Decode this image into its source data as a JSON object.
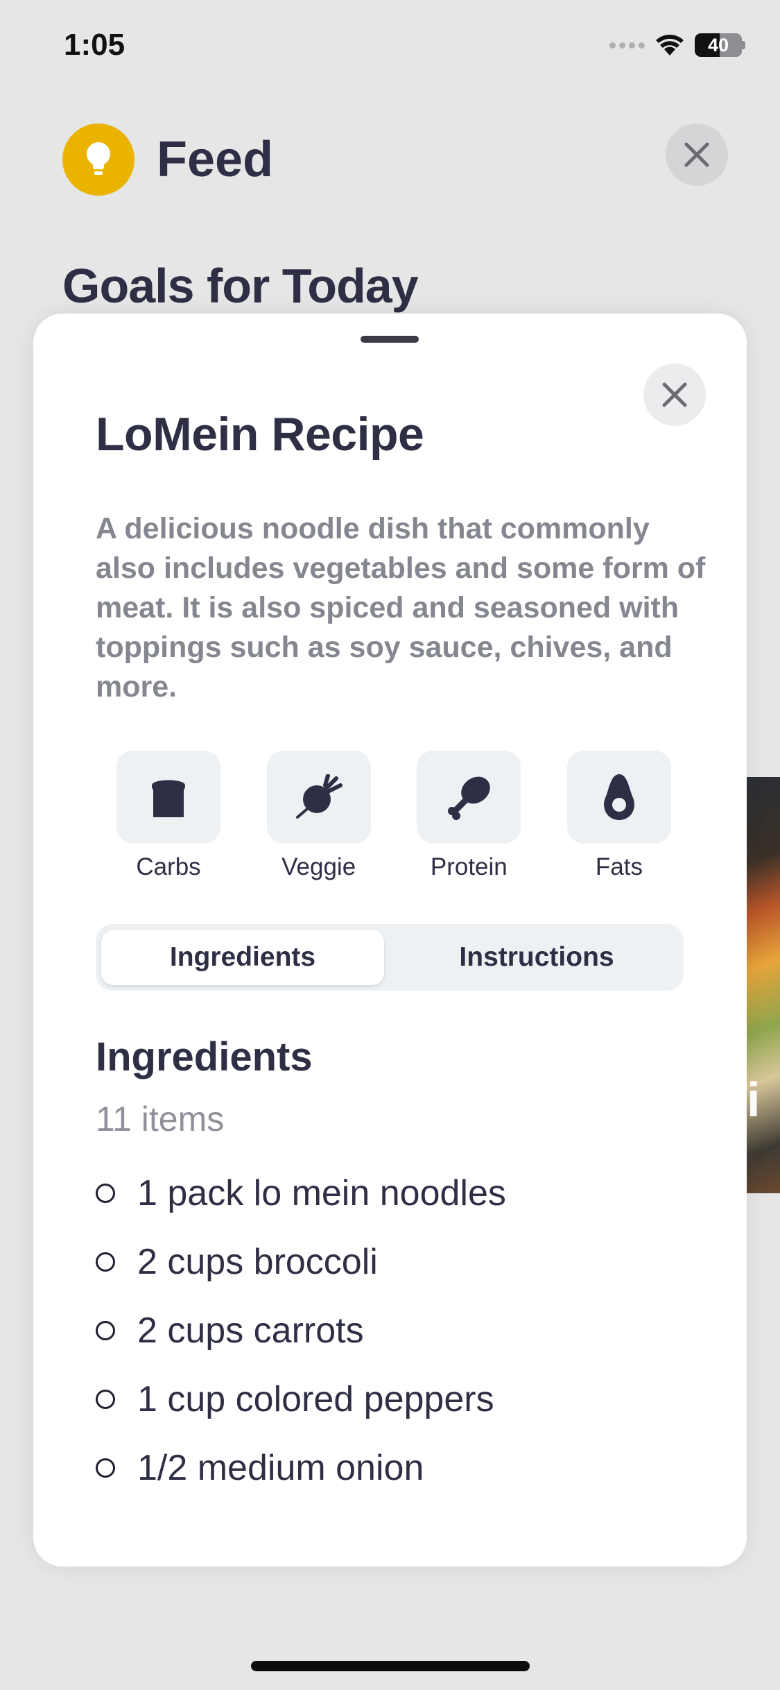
{
  "status_bar": {
    "time": "1:05",
    "battery": "40"
  },
  "header": {
    "title": "Feed"
  },
  "background": {
    "section_title": "Goals for Today",
    "peek_card_text": "i"
  },
  "sheet": {
    "title": "LoMein Recipe",
    "description": "A delicious noodle dish that commonly also includes vegetables and some form of meat. It is also spiced and seasoned with toppings such as soy sauce, chives, and more.",
    "macros": [
      {
        "label": "Carbs",
        "icon": "bread-icon"
      },
      {
        "label": "Veggie",
        "icon": "beet-icon"
      },
      {
        "label": "Protein",
        "icon": "drumstick-icon"
      },
      {
        "label": "Fats",
        "icon": "avocado-icon"
      }
    ],
    "tabs": [
      {
        "label": "Ingredients",
        "selected": true
      },
      {
        "label": "Instructions",
        "selected": false
      }
    ],
    "ingredients": {
      "heading": "Ingredients",
      "count": "11 items",
      "items": [
        "1 pack lo mein noodles",
        "2 cups broccoli",
        "2 cups carrots",
        "1 cup colored peppers",
        "1/2 medium onion"
      ]
    }
  },
  "colors": {
    "accent": "#e9b300",
    "text": "#2e2f45",
    "muted": "#848690",
    "tile": "#eef1f3"
  }
}
